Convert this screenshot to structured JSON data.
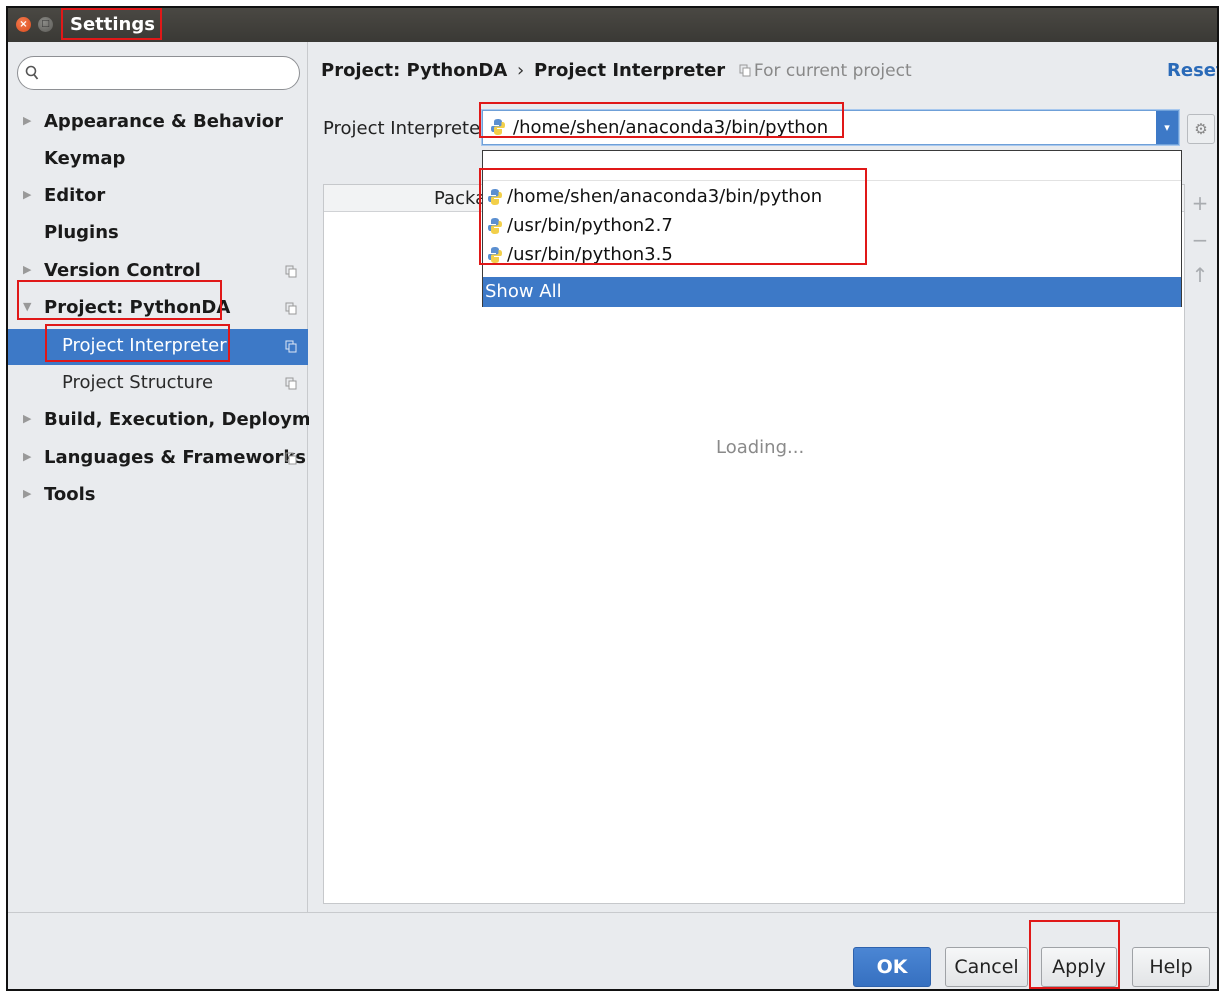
{
  "window": {
    "title": "Settings",
    "close_glyph": "×",
    "min_glyph": "□"
  },
  "search": {
    "placeholder": ""
  },
  "sidebar": {
    "items": [
      {
        "label": "Appearance & Behavior",
        "expandable": true
      },
      {
        "label": "Keymap",
        "expandable": false
      },
      {
        "label": "Editor",
        "expandable": true
      },
      {
        "label": "Plugins",
        "expandable": false
      },
      {
        "label": "Version Control",
        "expandable": true
      },
      {
        "label": "Project: PythonDA",
        "expandable": true,
        "expanded": true
      },
      {
        "label": "Project Interpreter",
        "child": true,
        "selected": true
      },
      {
        "label": "Project Structure",
        "child": true
      },
      {
        "label": "Build, Execution, Deployment",
        "expandable": true
      },
      {
        "label": "Languages & Frameworks",
        "expandable": true
      },
      {
        "label": "Tools",
        "expandable": true
      }
    ]
  },
  "header": {
    "crumb_project": "Project: PythonDA",
    "crumb_sep": "›",
    "crumb_page": "Project Interpreter",
    "note": "For current project",
    "reset": "Reset"
  },
  "interpreter": {
    "label": "Project Interpreter:",
    "value": "/home/shen/anaconda3/bin/python",
    "dropdown_arrow": "▾",
    "gear_glyph": "⚙"
  },
  "dropdown": {
    "options": [
      "/home/shen/anaconda3/bin/python",
      "/usr/bin/python2.7",
      "/usr/bin/python3.5"
    ],
    "show_all": "Show All"
  },
  "packages": {
    "header": "Package",
    "loading": "Loading..."
  },
  "tools": {
    "add": "+",
    "remove": "−",
    "upgrade": "↑"
  },
  "footer": {
    "ok": "OK",
    "cancel": "Cancel",
    "apply": "Apply",
    "help": "Help"
  },
  "colors": {
    "selection": "#3d79c7",
    "annotation": "#e01818",
    "link": "#2a6ab8"
  }
}
